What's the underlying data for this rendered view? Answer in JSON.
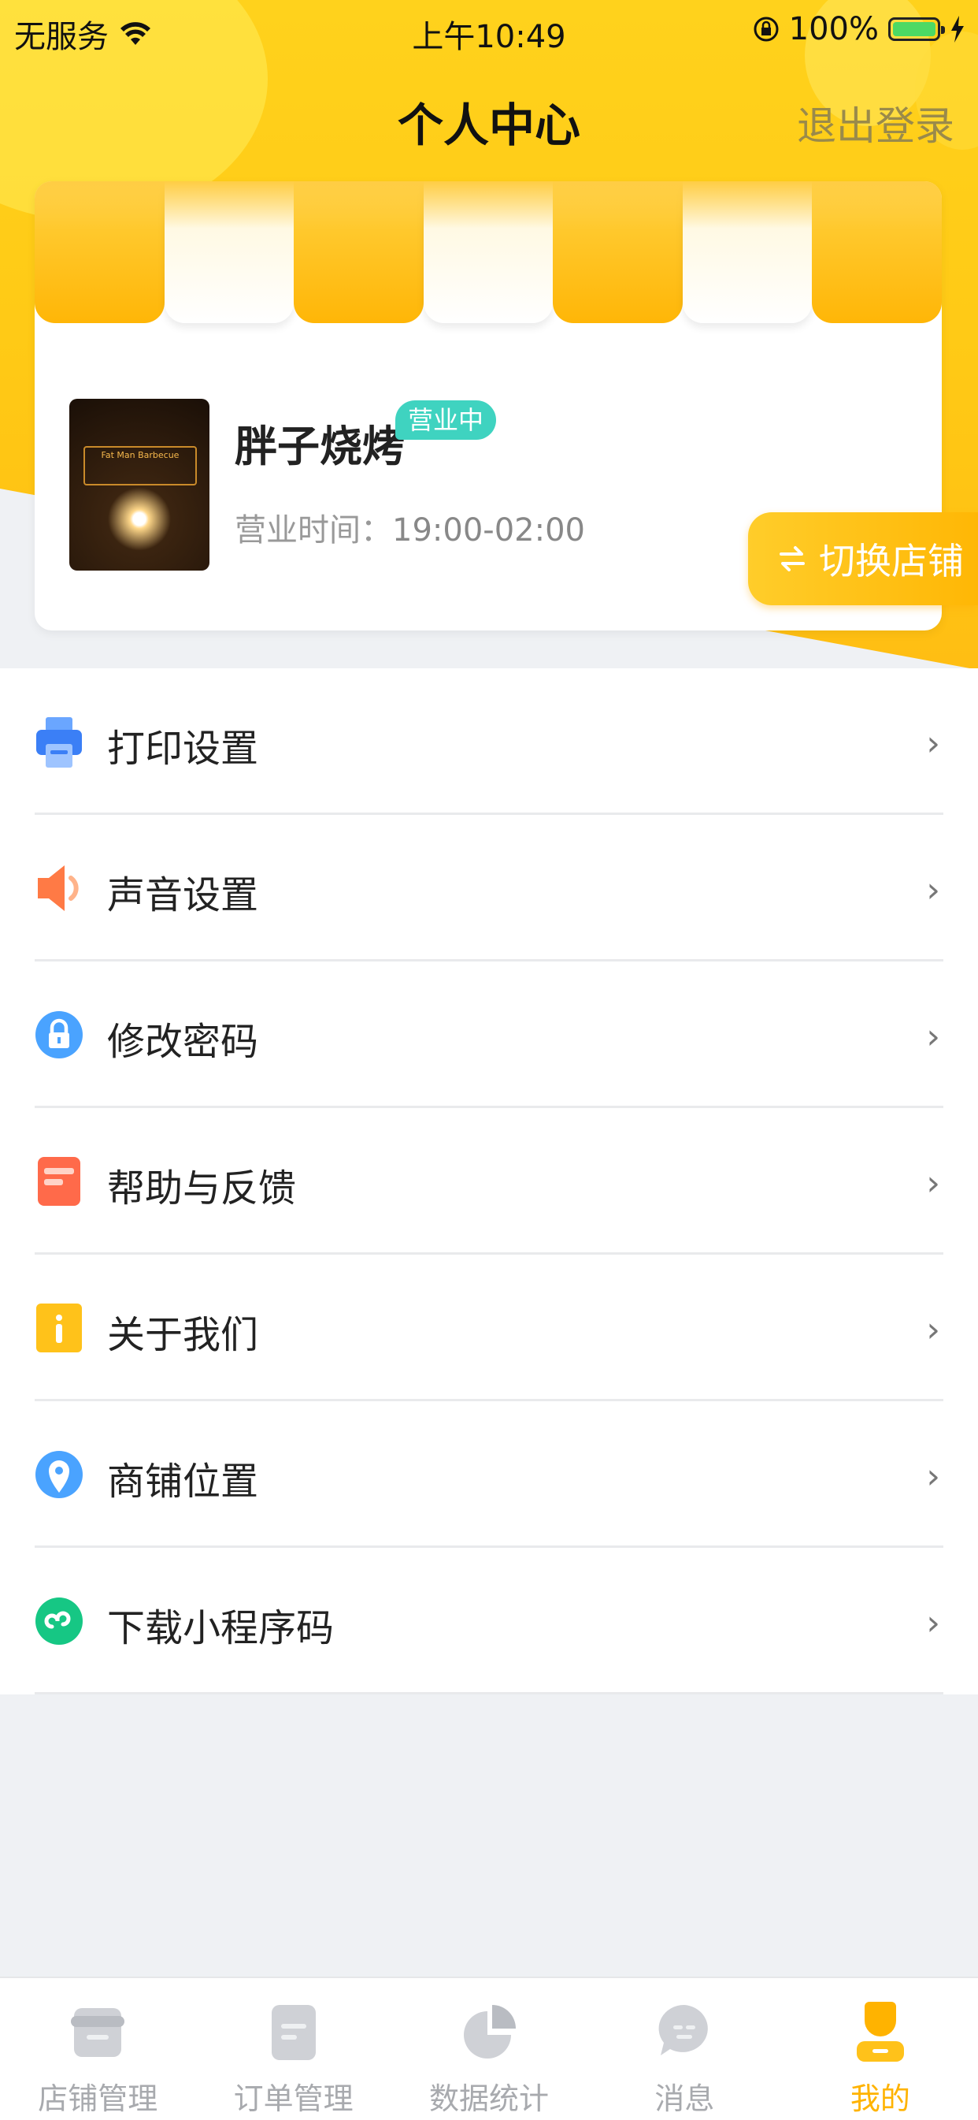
{
  "status_bar": {
    "carrier": "无服务",
    "time": "上午10:49",
    "battery": "100%"
  },
  "header": {
    "title": "个人中心",
    "logout_label": "退出登录"
  },
  "shop": {
    "name": "胖子烧烤",
    "status_badge": "营业中",
    "hours_label": "营业时间：",
    "hours_value": "19:00-02:00",
    "switch_label": "切换店铺",
    "photo_sign_text": "Fat Man Barbecue"
  },
  "menu": {
    "items": [
      {
        "label": "打印设置",
        "icon": "printer-icon"
      },
      {
        "label": "声音设置",
        "icon": "speaker-icon"
      },
      {
        "label": "修改密码",
        "icon": "lock-icon"
      },
      {
        "label": "帮助与反馈",
        "icon": "help-feedback-icon"
      },
      {
        "label": "关于我们",
        "icon": "info-icon"
      },
      {
        "label": "商铺位置",
        "icon": "location-pin-icon"
      },
      {
        "label": "下载小程序码",
        "icon": "mini-program-icon"
      }
    ]
  },
  "tabbar": {
    "items": [
      {
        "label": "店铺管理",
        "icon": "store-icon",
        "active": false
      },
      {
        "label": "订单管理",
        "icon": "order-icon",
        "active": false
      },
      {
        "label": "数据统计",
        "icon": "pie-chart-icon",
        "active": false
      },
      {
        "label": "消息",
        "icon": "message-icon",
        "active": false
      },
      {
        "label": "我的",
        "icon": "profile-icon",
        "active": true
      }
    ]
  },
  "colors": {
    "brand_yellow": "#ffc915",
    "badge_teal": "#3fd3c0",
    "active_tab": "#ffb300",
    "inactive_tab": "#a8aaae"
  }
}
